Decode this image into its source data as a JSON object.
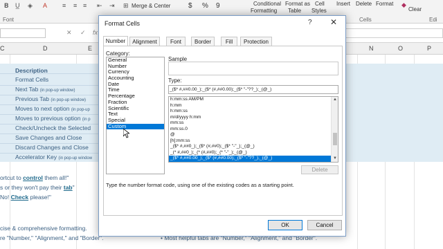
{
  "ribbon": {
    "font_group": "Font",
    "merge_center": "Merge & Center",
    "currency_symbol": "$",
    "percent_symbol": "%",
    "comma_symbol": "9",
    "conditional_formatting_line1": "Conditional",
    "conditional_formatting_line2": "Formatting",
    "format_as_table_line1": "Format as",
    "format_as_table_line2": "Table",
    "cell_styles_line1": "Cell",
    "cell_styles_line2": "Styles",
    "insert": "Insert",
    "delete": "Delete",
    "format": "Format",
    "clear": "Clear",
    "cells_group": "Cells",
    "editing_group": "Edi"
  },
  "formula_bar": {
    "cancel_symbol": "✕",
    "enter_symbol": "✓",
    "fx_symbol": "fx"
  },
  "columns": [
    "C",
    "D",
    "E",
    "N",
    "O",
    "P"
  ],
  "sheet": {
    "header": "Description",
    "rows": [
      {
        "text": "Format Cells",
        "small": ""
      },
      {
        "text": "Next Tab",
        "small": "(in pop-up window)"
      },
      {
        "text": "Previous Tab",
        "small": "(in pop-up window)"
      },
      {
        "text": "Moves to next option",
        "small": "(in pop-up"
      },
      {
        "text": "Moves to previous option",
        "small": "(in p"
      },
      {
        "text": "Check/Uncheck the Selected",
        "small": ""
      },
      {
        "text": "Save Changes and Close",
        "small": ""
      },
      {
        "text": "Discard Changes and Close",
        "small": ""
      },
      {
        "text": "Accelerator Key",
        "small": "(in pop-up window"
      }
    ],
    "note1_pre": "ortcut to ",
    "note1_bold": "control",
    "note1_post": " them all!\"",
    "note2_pre": "s or they won't pay their ",
    "note2_bold": "tab",
    "note2_post": "\"",
    "note3_pre": " No! ",
    "note3_bold": "Check",
    "note3_post": " please!\"",
    "note4": "cise & comprehensive formatting.",
    "note5": "re \"Number,\" \"Alignment,\" and \"Border\".",
    "bottom_right": "•  Most helpful tabs are \"Number,\" \"Alignment,\" and \"Border\"."
  },
  "dialog": {
    "title": "Format Cells",
    "help": "?",
    "close": "✕",
    "tabs": [
      "Number",
      "Alignment",
      "Font",
      "Border",
      "Fill",
      "Protection"
    ],
    "category_label": "Category:",
    "categories": [
      "General",
      "Number",
      "Currency",
      "Accounting",
      "Date",
      "Time",
      "Percentage",
      "Fraction",
      "Scientific",
      "Text",
      "Special",
      "Custom"
    ],
    "selected_category": "Custom",
    "sample_label": "Sample",
    "type_label": "Type:",
    "type_value": "_($* #,##0.00_);_($* (#,##0.00);_($* \"-\"??_);_(@_)",
    "formats": [
      "h:mm:ss AM/PM",
      "h:mm",
      "h:mm:ss",
      "m/d/yyyy h:mm",
      "mm:ss",
      "mm:ss.0",
      "@",
      "[h]:mm:ss",
      "_($* #,##0_);_($* (#,##0);_($* \"-\"_);_(@_)",
      "_(* #,##0_);_(* (#,##0);_(* \"-\"_);_(@_)",
      "_($* #,##0.00_);_($* (#,##0.00);_($* \"-\"??_);_(@_)"
    ],
    "selected_format": "_($* #,##0.00_);_($* (#,##0.00);_($* \"-\"??_);_(@_)",
    "delete_label": "Delete",
    "hint": "Type the number format code, using one of the existing codes as a starting point.",
    "ok_label": "OK",
    "cancel_label": "Cancel"
  },
  "colors": {
    "accent": "#0078d7",
    "sheet_band": "#dfecf4",
    "sheet_text": "#3a5f82"
  }
}
